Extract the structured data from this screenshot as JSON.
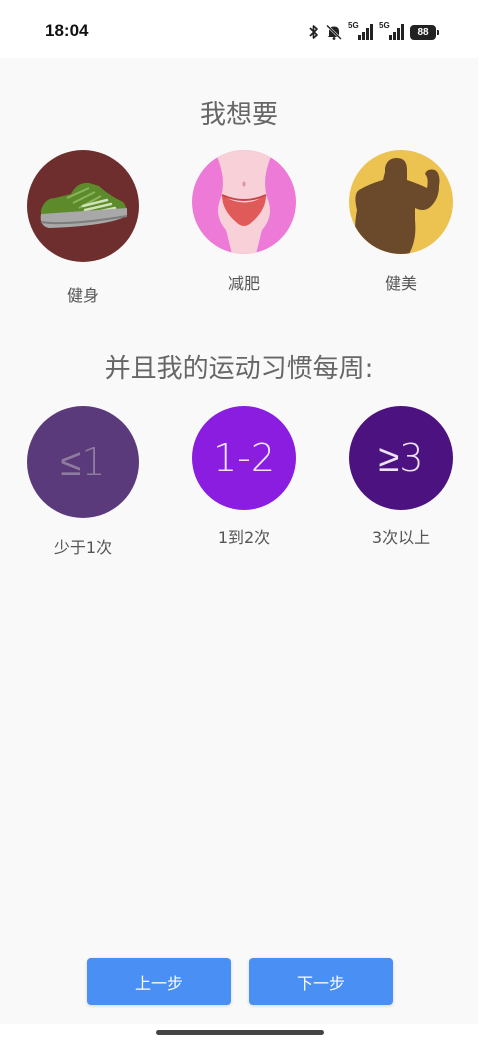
{
  "status_bar": {
    "time": "18:04",
    "signal_1_label": "5G",
    "signal_2_label": "5G",
    "battery": "88"
  },
  "goal_section": {
    "title": "我想要",
    "options": [
      {
        "label": "健身",
        "icon": "sneaker-icon",
        "color": "#6e2e2e"
      },
      {
        "label": "减肥",
        "icon": "waist-icon",
        "color": "#ec7ad6"
      },
      {
        "label": "健美",
        "icon": "muscle-icon",
        "color": "#ecc250"
      }
    ]
  },
  "frequency_section": {
    "title": "并且我的运动习惯每周:",
    "options": [
      {
        "symbol": "≤1",
        "label": "少于1次",
        "color": "#5a3a7a"
      },
      {
        "symbol": "1-2",
        "label": "1到2次",
        "color": "#8a1de0"
      },
      {
        "symbol": "≥3",
        "label": "3次以上",
        "color": "#4c1280"
      }
    ]
  },
  "buttons": {
    "prev": "上一步",
    "next": "下一步"
  }
}
